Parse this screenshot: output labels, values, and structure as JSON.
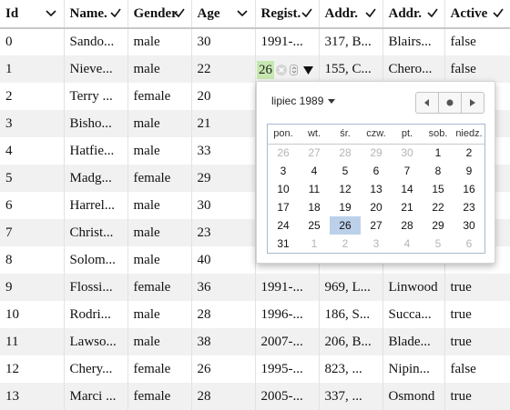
{
  "columns": [
    {
      "label": "Id",
      "icon": "chevron-down-icon"
    },
    {
      "label": "Name.",
      "icon": "filter-icon"
    },
    {
      "label": "Gender",
      "icon": "filter-icon"
    },
    {
      "label": "Age",
      "icon": "chevron-down-icon"
    },
    {
      "label": "Regist.",
      "icon": "filter-icon"
    },
    {
      "label": "Addr.",
      "icon": "filter-icon"
    },
    {
      "label": "Addr.",
      "icon": "filter-icon"
    },
    {
      "label": "Active",
      "icon": "filter-icon"
    }
  ],
  "rows": [
    [
      "0",
      "Sando...",
      "male",
      "30",
      "1991-...",
      "317, B...",
      "Blairs...",
      "false"
    ],
    [
      "1",
      "Nieve...",
      "male",
      "22",
      "",
      "155, C...",
      "Chero...",
      "false"
    ],
    [
      "2",
      "Terry ...",
      "female",
      "20",
      "",
      "",
      "",
      ""
    ],
    [
      "3",
      "Bisho...",
      "male",
      "21",
      "",
      "",
      "",
      ""
    ],
    [
      "4",
      "Hatfie...",
      "male",
      "33",
      "",
      "",
      "",
      ""
    ],
    [
      "5",
      "Madg...",
      "female",
      "29",
      "",
      "",
      "",
      ""
    ],
    [
      "6",
      "Harrel...",
      "male",
      "30",
      "",
      "",
      "",
      ""
    ],
    [
      "7",
      "Christ...",
      "male",
      "23",
      "",
      "",
      "",
      ""
    ],
    [
      "8",
      "Solom...",
      "male",
      "40",
      "",
      "",
      "",
      ""
    ],
    [
      "9",
      "Flossi...",
      "female",
      "36",
      "1991-...",
      "969, L...",
      "Linwood",
      "true"
    ],
    [
      "10",
      "Rodri...",
      "male",
      "28",
      "1996-...",
      "186, S...",
      "Succa...",
      "true"
    ],
    [
      "11",
      "Lawso...",
      "male",
      "38",
      "2007-...",
      "206, B...",
      "Blade...",
      "true"
    ],
    [
      "12",
      "Chery...",
      "female",
      "26",
      "1995-...",
      "823, ...",
      "Nipin...",
      "false"
    ],
    [
      "13",
      "Marci ...",
      "female",
      "28",
      "2005-...",
      "337, ...",
      "Osmond",
      "true"
    ]
  ],
  "date_editor": {
    "day_value": "26",
    "icons": [
      "clear-icon",
      "spinner-icon",
      "dropdown-arrow-icon"
    ],
    "highlight_color": "#c6e8b0"
  },
  "calendar": {
    "month_label": "lipiec 1989",
    "nav_icons": [
      "chevron-left-icon",
      "today-dot-icon",
      "chevron-right-icon"
    ],
    "weekdays": [
      "pon.",
      "wt.",
      "śr.",
      "czw.",
      "pt.",
      "sob.",
      "niedz."
    ],
    "weeks": [
      [
        {
          "d": "26",
          "o": true
        },
        {
          "d": "27",
          "o": true
        },
        {
          "d": "28",
          "o": true
        },
        {
          "d": "29",
          "o": true
        },
        {
          "d": "30",
          "o": true
        },
        {
          "d": "1",
          "o": false
        },
        {
          "d": "2",
          "o": false
        }
      ],
      [
        {
          "d": "3",
          "o": false
        },
        {
          "d": "4",
          "o": false
        },
        {
          "d": "5",
          "o": false
        },
        {
          "d": "6",
          "o": false
        },
        {
          "d": "7",
          "o": false
        },
        {
          "d": "8",
          "o": false
        },
        {
          "d": "9",
          "o": false
        }
      ],
      [
        {
          "d": "10",
          "o": false
        },
        {
          "d": "11",
          "o": false
        },
        {
          "d": "12",
          "o": false
        },
        {
          "d": "13",
          "o": false
        },
        {
          "d": "14",
          "o": false
        },
        {
          "d": "15",
          "o": false
        },
        {
          "d": "16",
          "o": false
        }
      ],
      [
        {
          "d": "17",
          "o": false
        },
        {
          "d": "18",
          "o": false
        },
        {
          "d": "19",
          "o": false
        },
        {
          "d": "20",
          "o": false
        },
        {
          "d": "21",
          "o": false
        },
        {
          "d": "22",
          "o": false
        },
        {
          "d": "23",
          "o": false
        }
      ],
      [
        {
          "d": "24",
          "o": false
        },
        {
          "d": "25",
          "o": false
        },
        {
          "d": "26",
          "o": false,
          "sel": true
        },
        {
          "d": "27",
          "o": false
        },
        {
          "d": "28",
          "o": false
        },
        {
          "d": "29",
          "o": false
        },
        {
          "d": "30",
          "o": false
        }
      ],
      [
        {
          "d": "31",
          "o": false
        },
        {
          "d": "1",
          "o": true
        },
        {
          "d": "2",
          "o": true
        },
        {
          "d": "3",
          "o": true
        },
        {
          "d": "4",
          "o": true
        },
        {
          "d": "5",
          "o": true
        },
        {
          "d": "6",
          "o": true
        }
      ]
    ],
    "selected_color": "#bcd0ea"
  }
}
